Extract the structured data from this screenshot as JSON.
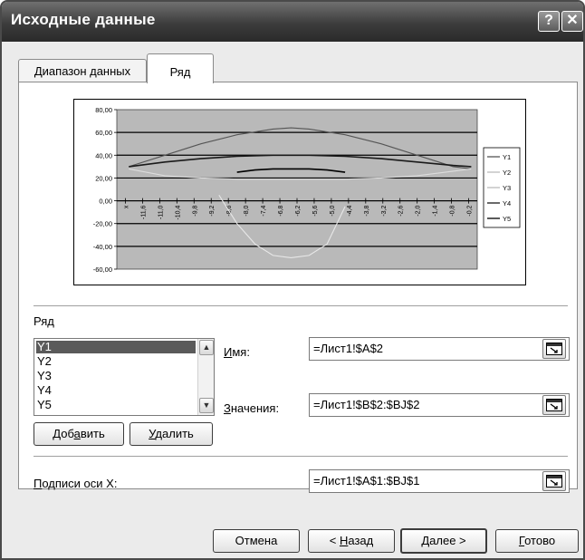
{
  "window": {
    "title": "Исходные данные",
    "help_label": "?",
    "close_label": "✕"
  },
  "tabs": [
    {
      "label": "Диапазон данных",
      "active": false
    },
    {
      "label": "Ряд",
      "active": true
    }
  ],
  "chart_data": {
    "type": "line",
    "title": "",
    "ylim": [
      -60,
      80
    ],
    "y_ticks": [
      "80,00",
      "60,00",
      "40,00",
      "20,00",
      "0,00",
      "-20,00",
      "-40,00",
      "-60,00"
    ],
    "x_ticks": [
      "x",
      "-11,6",
      "-11,0",
      "-10,4",
      "-9,8",
      "-9,2",
      "-8,6",
      "-8,0",
      "-7,4",
      "-6,8",
      "-6,2",
      "-5,6",
      "-5,0",
      "-4,4",
      "-3,8",
      "-3,2",
      "-2,6",
      "-2,0",
      "-1,4",
      "-0,8",
      "-0,2"
    ],
    "xlim": [
      -12,
      0
    ],
    "grid": true,
    "legend_position": "right",
    "series": [
      {
        "name": "Y1",
        "color": "#555555",
        "x": [
          -11.6,
          -10.4,
          -9.2,
          -8.0,
          -6.8,
          -6.2,
          -5.6,
          -4.4,
          -3.2,
          -2.0,
          -0.8,
          -0.2
        ],
        "values": [
          30,
          40,
          50,
          58,
          63,
          64,
          63,
          58,
          50,
          40,
          30,
          28
        ]
      },
      {
        "name": "Y2",
        "color": "#dddddd",
        "x": [
          -11.6,
          -10.4,
          -9.2,
          -8.0,
          -6.8,
          -6.2,
          -5.6,
          -4.4,
          -3.2,
          -2.0,
          -0.8,
          -0.2
        ],
        "values": [
          28,
          22,
          20,
          19,
          19,
          19,
          19,
          19,
          20,
          22,
          26,
          28
        ]
      },
      {
        "name": "Y3",
        "color": "#e8e8e8",
        "x": [
          -8.6,
          -8.0,
          -7.4,
          -6.8,
          -6.2,
          -5.6,
          -5.0,
          -4.4
        ],
        "values": [
          5,
          -20,
          -38,
          -48,
          -50,
          -48,
          -38,
          -5
        ]
      },
      {
        "name": "Y4",
        "color": "#1a1a1a",
        "x": [
          -11.6,
          -10.4,
          -9.2,
          -8.0,
          -6.8,
          -6.2,
          -5.6,
          -4.4,
          -3.2,
          -2.0,
          -0.8,
          -0.2
        ],
        "values": [
          30,
          34,
          37,
          39,
          40,
          40,
          40,
          39,
          37,
          34,
          31,
          30
        ]
      },
      {
        "name": "Y5",
        "color": "#000000",
        "x": [
          -8.0,
          -7.4,
          -6.8,
          -6.2,
          -5.6,
          -5.0,
          -4.4
        ],
        "values": [
          25,
          27,
          28,
          28,
          28,
          27,
          25
        ]
      }
    ]
  },
  "series_section": {
    "label": "Ряд",
    "items": [
      "Y1",
      "Y2",
      "Y3",
      "Y4",
      "Y5"
    ],
    "selected": "Y1",
    "add_label_pre": "Доб",
    "add_label_ul": "а",
    "add_label_post": "вить",
    "remove_label_ul": "У",
    "remove_label_post": "далить"
  },
  "fields": {
    "name_label_ul": "И",
    "name_label_post": "мя:",
    "name_value": "=Лист1!$A$2",
    "values_label_ul": "З",
    "values_label_post": "начения:",
    "values_value": "=Лист1!$B$2:$BJ$2",
    "xlabels_label_ul": "П",
    "xlabels_label_post": "одписи оси X:",
    "xlabels_value": "=Лист1!$A$1:$BJ$1"
  },
  "footer": {
    "cancel_label": "Отмена",
    "back_pre": "< ",
    "back_ul": "Н",
    "back_post": "азад",
    "next_ul": "Д",
    "next_post": "алее >",
    "finish_ul": "Г",
    "finish_post": "отово"
  }
}
